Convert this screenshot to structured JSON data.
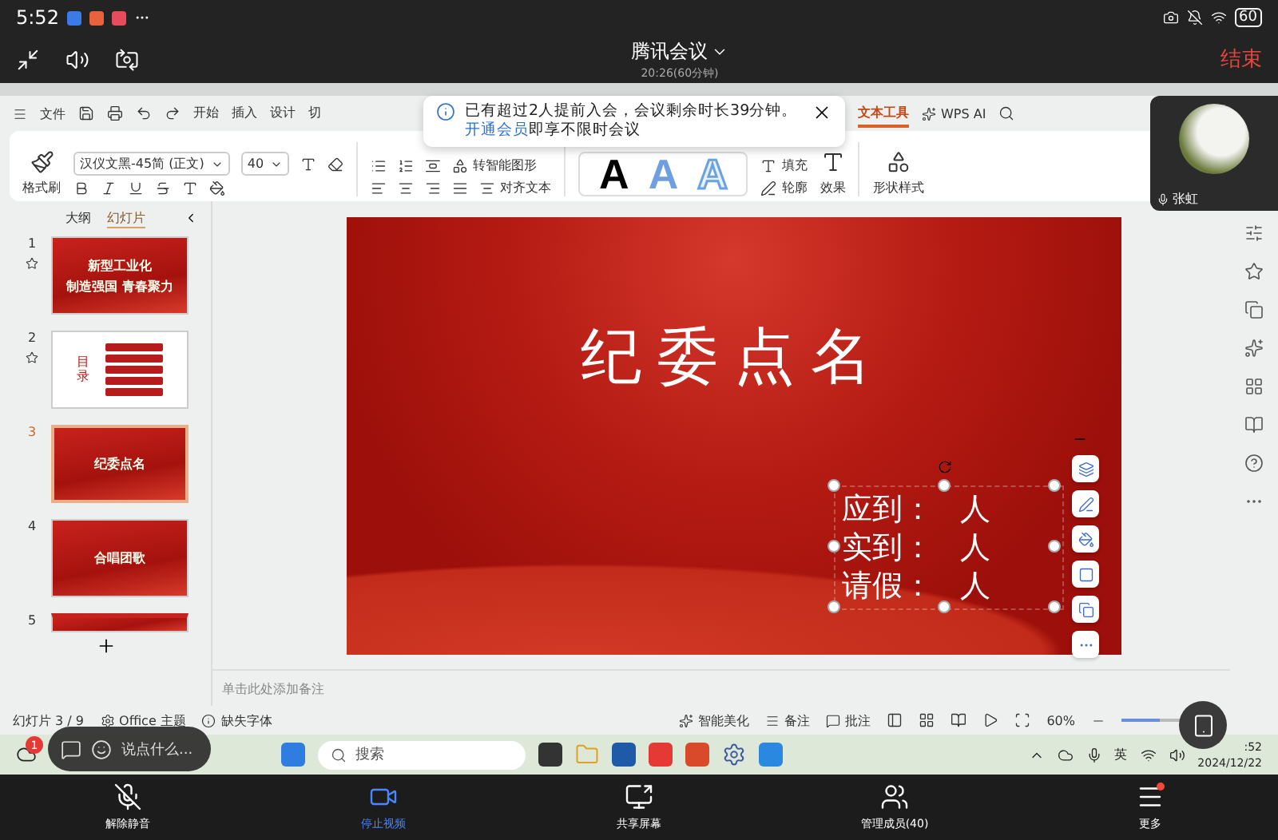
{
  "phone_status": {
    "time": "5:52",
    "battery": "60"
  },
  "meeting": {
    "title": "腾讯会议",
    "subtitle": "20:26(60分钟)",
    "end_button": "结束"
  },
  "notice": {
    "text": "已有超过2人提前入会，会议剩余时长39分钟。",
    "link": "开通会员",
    "rest": "即享不限时会议"
  },
  "video_tile": {
    "name": "张虹"
  },
  "menu": {
    "file": "文件",
    "tabs": [
      {
        "label": "开始",
        "selected": false
      },
      {
        "label": "插入",
        "selected": false
      },
      {
        "label": "设计",
        "selected": false
      },
      {
        "label": "切",
        "selected": false
      },
      {
        "label": "文本工具",
        "selected": true
      }
    ],
    "ai": "WPS AI"
  },
  "ribbon": {
    "format_painter": "格式刷",
    "font": "汉仪文黑-45简 (正文)",
    "size": "40",
    "smart_graphic": "转智能图形",
    "align_text": "对齐文本",
    "text_styles": [
      {
        "label": "A",
        "kind": "solid"
      },
      {
        "label": "A",
        "kind": "gradient"
      },
      {
        "label": "A",
        "kind": "outline"
      }
    ],
    "fill": "填充",
    "outline": "轮廓",
    "effect": "效果",
    "shape_style": "形状样式"
  },
  "panel": {
    "tabs": [
      {
        "label": "大纲",
        "selected": false
      },
      {
        "label": "幻灯片",
        "selected": true
      }
    ],
    "slides": [
      {
        "number": "1",
        "starred": true,
        "selected": false,
        "kind": "cover",
        "lines": [
          "新型工业化",
          "制造强国  青春聚力"
        ]
      },
      {
        "number": "2",
        "starred": true,
        "selected": false,
        "kind": "contents",
        "lines": [
          "目录"
        ]
      },
      {
        "number": "3",
        "starred": false,
        "selected": true,
        "kind": "cover",
        "lines": [
          "纪委点名"
        ]
      },
      {
        "number": "4",
        "starred": false,
        "selected": false,
        "kind": "cover",
        "lines": [
          "合唱团歌"
        ]
      },
      {
        "number": "5",
        "starred": false,
        "selected": false,
        "kind": "partial"
      }
    ]
  },
  "slide": {
    "title": "纪委点名",
    "roster": [
      {
        "label": "应到：",
        "unit": "人"
      },
      {
        "label": "实到：",
        "unit": "人"
      },
      {
        "label": "请假：",
        "unit": "人"
      }
    ]
  },
  "notes_placeholder": "单击此处添加备注",
  "status": {
    "counter": "幻灯片 3 / 9",
    "theme": "Office 主题",
    "missing_font": "缺失字体",
    "beautify": "智能美化",
    "notes": "备注",
    "comments": "批注",
    "zoom": "60%",
    "zoom_level": {
      "level": 0.6
    }
  },
  "chat": {
    "badge": "1",
    "placeholder": "说点什么..."
  },
  "taskbar": {
    "search": "搜索",
    "ime": "英",
    "time": ":52",
    "date": "2024/12/22"
  },
  "controls": [
    {
      "label": "解除静音",
      "kind": "mic_off",
      "active": false,
      "badge": false
    },
    {
      "label": "停止视频",
      "kind": "video",
      "active": true,
      "badge": false
    },
    {
      "label": "共享屏幕",
      "kind": "share",
      "active": false,
      "badge": false
    },
    {
      "label": "管理成员(40)",
      "kind": "members",
      "active": false,
      "badge": false
    },
    {
      "label": "更多",
      "kind": "more",
      "active": false,
      "badge": true
    }
  ]
}
